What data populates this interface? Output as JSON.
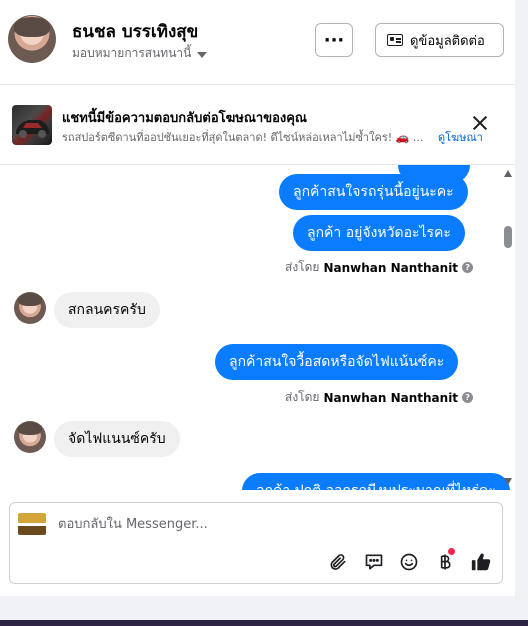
{
  "header": {
    "name": "ธนชล บรรเทิงสุข",
    "assign_label": "มอบหมายการสนทนานี้",
    "more_label": "···",
    "contact_label": "ดูข้อมูลติดต่อ"
  },
  "ad_banner": {
    "title": "แชทนี้มีข้อความตอบกลับต่อโฆษณาของคุณ",
    "subtitle": "รถสปอร์ตซีดานที่ออปชันเยอะที่สุดในตลาด! ดีไซน์หล่อเหลาไม่ซ้ำใคร! 🚗 ...",
    "link_label": "ดูโฆษณา"
  },
  "messages": {
    "out1": "ลูกค้าสนใจรถรุ่นนี้อยู่นะคะ",
    "out2": "ลูกค้า อยู่จังหวัดอะไรคะ",
    "sent_by_prefix": "ส่งโดย",
    "sent_by_name": "Nanwhan Nanthanit",
    "in1": "สกลนครครับ",
    "out3": "ลูกค้าสนใจวื้อสดหรือจัดไฟแน้นซ์คะ",
    "in2": "จัดไฟแนนซ์ครับ",
    "out4_partial": "ลูกค้า ปกติ ออกรถมีงบประมาณที่ไหร่คะ"
  },
  "composer": {
    "placeholder": "ตอบกลับใน Messenger..."
  },
  "icons": {
    "attach": "paperclip-icon",
    "reply_templates": "chat-bubble-icon",
    "emoji": "smiley-icon",
    "payment": "baht-icon",
    "like": "thumbs-up-icon"
  },
  "colors": {
    "outgoing_bubble": "#0a7cff",
    "incoming_bubble": "#f0f0f0",
    "link": "#0064d1",
    "notification_dot": "#f02849"
  }
}
